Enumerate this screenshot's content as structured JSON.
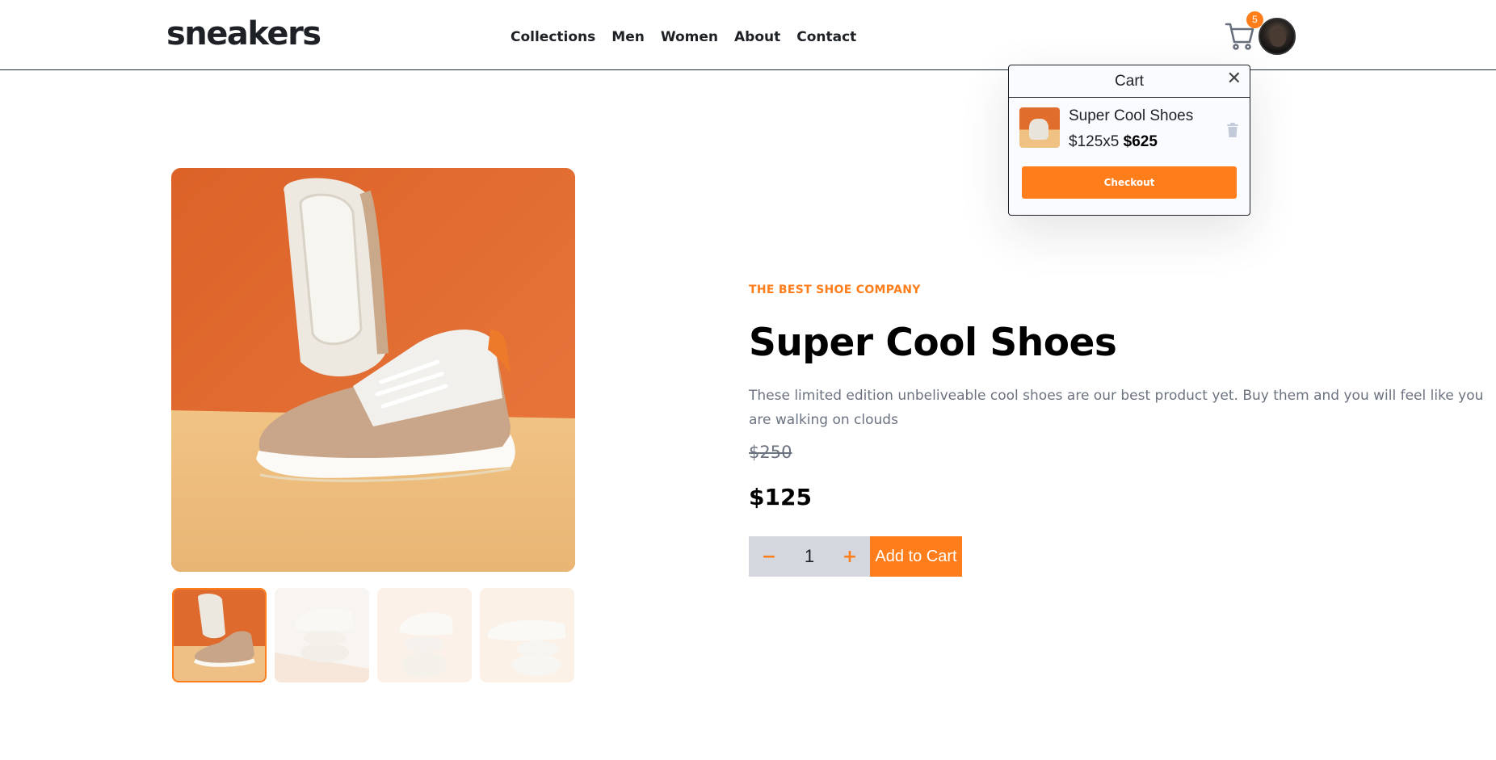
{
  "header": {
    "logo": "sneakers",
    "nav": [
      "Collections",
      "Men",
      "Women",
      "About",
      "Contact"
    ],
    "cart_count": "5",
    "cart_icon": "cart-icon",
    "avatar": "avatar"
  },
  "cart": {
    "title": "Cart",
    "close_glyph": "✕",
    "item": {
      "name": "Super Cool Shoes",
      "unit_price": "$125x5",
      "total": "$625"
    },
    "checkout_label": "Checkout"
  },
  "gallery": {
    "thumbnail_count": 4,
    "active_thumbnail": 0
  },
  "product": {
    "company": "THE BEST SHOE COMPANY",
    "title": "Super Cool Shoes",
    "description": "These limited edition unbeliveable cool shoes are our best product yet. Buy them and you will feel like you are walking on clouds",
    "old_price": "$250",
    "price": "$125",
    "quantity": "1",
    "minus_glyph": "−",
    "plus_glyph": "+",
    "add_to_cart_label": "Add to Cart"
  },
  "colors": {
    "accent": "#ff7e1b",
    "text_dark": "#1d2025",
    "text_muted": "#6b7280",
    "qty_bg": "#d4d7de"
  }
}
